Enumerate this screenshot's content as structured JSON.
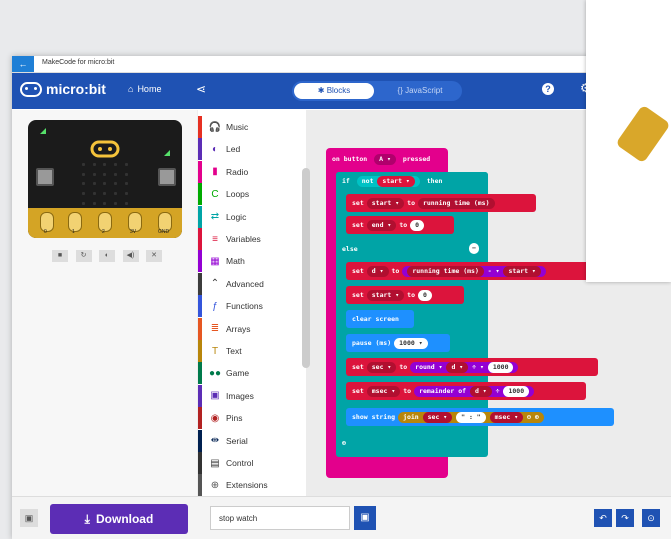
{
  "window": {
    "title": "MakeCode for micro:bit"
  },
  "header": {
    "brand": "micro:bit",
    "home": "Home",
    "tabs": {
      "blocks": "Blocks",
      "javascript": "JavaScript"
    }
  },
  "simulator": {
    "pins": [
      "0",
      "1",
      "2",
      "3V",
      "GND"
    ]
  },
  "toolbox": {
    "categories": [
      {
        "label": "Music",
        "color": "#e63022",
        "icon": "headphones-icon",
        "glyph": "🎧"
      },
      {
        "label": "Led",
        "color": "#5c2db5",
        "icon": "toggle-icon",
        "glyph": "◐"
      },
      {
        "label": "Radio",
        "color": "#e3008c",
        "icon": "signal-icon",
        "glyph": "▮"
      },
      {
        "label": "Loops",
        "color": "#00aa00",
        "icon": "loop-icon",
        "glyph": "C"
      },
      {
        "label": "Logic",
        "color": "#00a4a6",
        "icon": "shuffle-icon",
        "glyph": "⇄"
      },
      {
        "label": "Variables",
        "color": "#dc143c",
        "icon": "list-icon",
        "glyph": "≡"
      },
      {
        "label": "Math",
        "color": "#9400d3",
        "icon": "calculator-icon",
        "glyph": "▦"
      },
      {
        "label": "Advanced",
        "color": "#3c3c3c",
        "icon": "chevron-up-icon",
        "glyph": "⌃"
      },
      {
        "label": "Functions",
        "color": "#3455db",
        "icon": "function-icon",
        "glyph": "ƒ"
      },
      {
        "label": "Arrays",
        "color": "#e65722",
        "icon": "array-icon",
        "glyph": "≣"
      },
      {
        "label": "Text",
        "color": "#b8860b",
        "icon": "text-icon",
        "glyph": "T"
      },
      {
        "label": "Game",
        "color": "#007a4b",
        "icon": "gamepad-icon",
        "glyph": "●●"
      },
      {
        "label": "Images",
        "color": "#5c2db5",
        "icon": "image-icon",
        "glyph": "▣"
      },
      {
        "label": "Pins",
        "color": "#b22222",
        "icon": "pin-icon",
        "glyph": "◉"
      },
      {
        "label": "Serial",
        "color": "#002050",
        "icon": "usb-icon",
        "glyph": "⇹"
      },
      {
        "label": "Control",
        "color": "#333333",
        "icon": "control-icon",
        "glyph": "▤"
      },
      {
        "label": "Extensions",
        "color": "#555555",
        "icon": "plus-circle-icon",
        "glyph": "⊕"
      }
    ]
  },
  "code": {
    "event": "on button",
    "event_button": "A ▾",
    "event_action": "pressed",
    "if": "if",
    "not": "not",
    "start_var": "start ▾",
    "then": "then",
    "set": "set",
    "to": "to",
    "running_time": "running time (ms)",
    "end_var": "end ▾",
    "zero": "0",
    "else": "else",
    "d_var": "d ▾",
    "minus": "- ▾",
    "clear_screen": "clear screen",
    "pause": "pause (ms)",
    "pause_val": "1000 ▾",
    "sec_var": "sec ▾",
    "round": "round ▾",
    "divide": "÷ ▾",
    "thousand": "1000",
    "msec_var": "msec ▾",
    "remainder": "remainder of",
    "show_string": "show string",
    "join": "join",
    "colon": "\" : \""
  },
  "footer": {
    "download": "Download",
    "project_name": "stop watch"
  },
  "colors": {
    "primary": "#1f52b3",
    "download": "#5c2db5",
    "event": "#e3008c",
    "logic": "#00a4a6",
    "variables": "#dc143c",
    "basic": "#1e90ff"
  }
}
